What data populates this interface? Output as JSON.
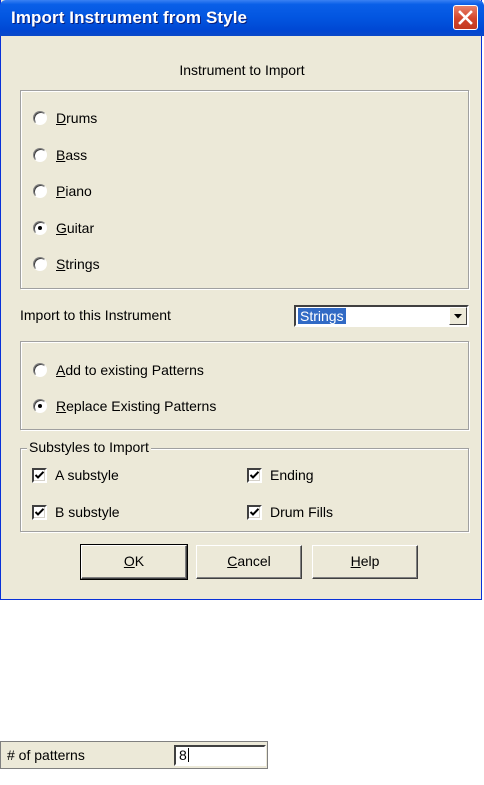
{
  "dialog": {
    "title": "Import Instrument from Style",
    "instrument_heading": "Instrument to Import",
    "instruments": [
      {
        "pre": "",
        "key": "D",
        "post": "rums",
        "checked": false
      },
      {
        "pre": "",
        "key": "B",
        "post": "ass",
        "checked": false
      },
      {
        "pre": "",
        "key": "P",
        "post": "iano",
        "checked": false
      },
      {
        "pre": "",
        "key": "G",
        "post": "uitar",
        "checked": true
      },
      {
        "pre": "",
        "key": "S",
        "post": "trings",
        "checked": false
      }
    ],
    "import_to_label": "Import to this Instrument",
    "import_to_value": "Strings",
    "mode_options": [
      {
        "key": "A",
        "post": "dd to existing Patterns",
        "checked": false
      },
      {
        "key": "R",
        "post": "eplace Existing Patterns",
        "checked": true
      }
    ],
    "substyles_legend": "Substyles to Import",
    "substyles": [
      {
        "label": "A substyle",
        "checked": true
      },
      {
        "label": "Ending",
        "checked": true
      },
      {
        "label": "B substyle",
        "checked": true
      },
      {
        "label": "Drum Fills",
        "checked": true
      }
    ],
    "buttons": {
      "ok": {
        "key": "O",
        "post": "K"
      },
      "cancel": {
        "key": "C",
        "post": "ancel"
      },
      "help": {
        "key": "H",
        "post": "elp"
      }
    }
  },
  "patterns_field": {
    "label": "# of patterns",
    "value": "8"
  },
  "icons": [
    "close-icon",
    "dropdown-arrow-icon",
    "checkmark-icon"
  ]
}
